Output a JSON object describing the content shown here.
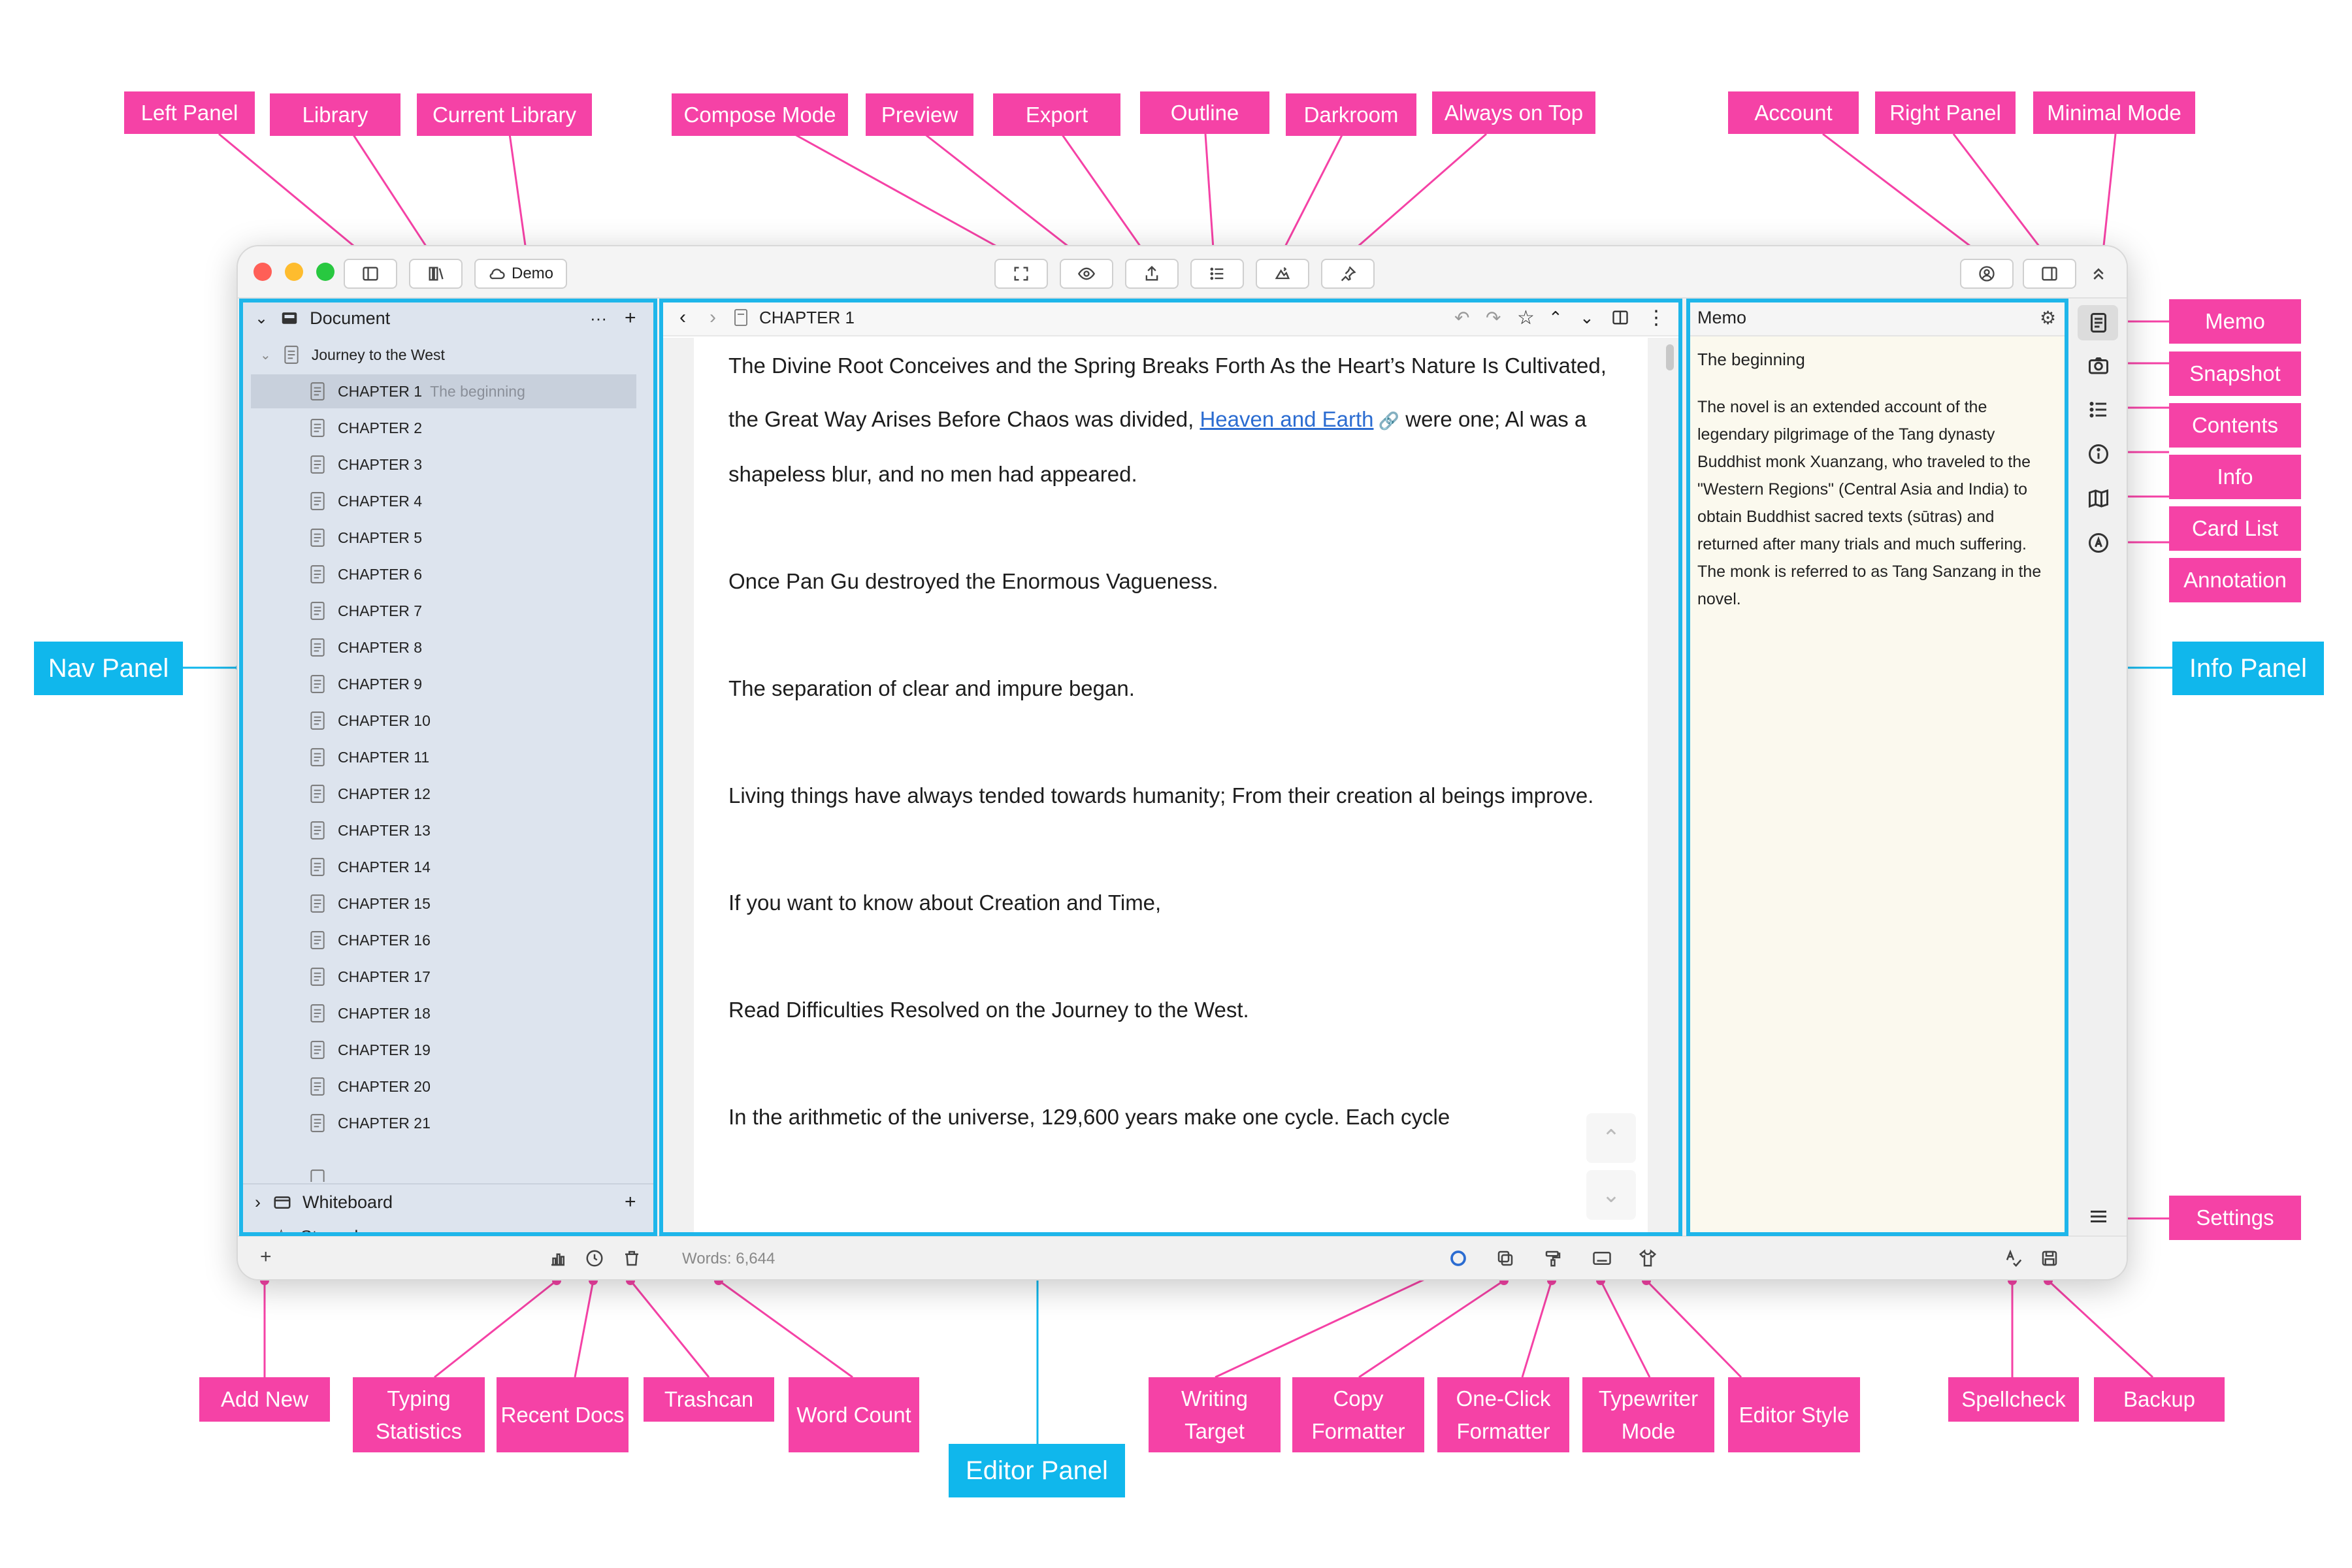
{
  "window": {
    "library_name": "Demo"
  },
  "nav": {
    "document_label": "Document",
    "more_label": "···",
    "add_label": "+",
    "root_doc": "Journey to the West",
    "chapters": [
      {
        "label": "CHAPTER 1",
        "sub": "The beginning"
      },
      {
        "label": "CHAPTER 2",
        "sub": ""
      },
      {
        "label": "CHAPTER 3",
        "sub": ""
      },
      {
        "label": "CHAPTER 4",
        "sub": ""
      },
      {
        "label": "CHAPTER 5",
        "sub": ""
      },
      {
        "label": "CHAPTER 6",
        "sub": ""
      },
      {
        "label": "CHAPTER 7",
        "sub": ""
      },
      {
        "label": "CHAPTER 8",
        "sub": ""
      },
      {
        "label": "CHAPTER 9",
        "sub": ""
      },
      {
        "label": "CHAPTER 10",
        "sub": ""
      },
      {
        "label": "CHAPTER 11",
        "sub": ""
      },
      {
        "label": "CHAPTER 12",
        "sub": ""
      },
      {
        "label": "CHAPTER 13",
        "sub": ""
      },
      {
        "label": "CHAPTER 14",
        "sub": ""
      },
      {
        "label": "CHAPTER 15",
        "sub": ""
      },
      {
        "label": "CHAPTER 16",
        "sub": ""
      },
      {
        "label": "CHAPTER 17",
        "sub": ""
      },
      {
        "label": "CHAPTER 18",
        "sub": ""
      },
      {
        "label": "CHAPTER 19",
        "sub": ""
      },
      {
        "label": "CHAPTER 20",
        "sub": ""
      },
      {
        "label": "CHAPTER 21",
        "sub": ""
      }
    ],
    "whiteboard_label": "Whiteboard",
    "starred_label": "Starred"
  },
  "editor": {
    "breadcrumb": "CHAPTER 1",
    "para1_a": "The Divine Root Conceives and the Spring Breaks Forth As the Heart’s Nature Is Cultivated, the Great Way Arises Before Chaos was divided, ",
    "para1_link": "Heaven and Earth",
    "para1_b": " were one; Al was a shapeless blur, and no men had appeared.",
    "para2": "Once Pan Gu destroyed the Enormous Vagueness.",
    "para3": "The separation of clear and impure began.",
    "para4": "Living things have always tended towards humanity; From their creation al beings improve.",
    "para5": "If you want to know about Creation and Time,",
    "para6": "Read Difficulties Resolved on the Journey to the West.",
    "para7": "In the arithmetic of the universe, 129,600 years make one cycle. Each cycle"
  },
  "info": {
    "header": "Memo",
    "title": "The beginning",
    "text": "The novel is an extended account of the legendary pilgrimage of the Tang dynasty Buddhist monk Xuanzang, who traveled to the \"Western Regions\" (Central Asia and India) to obtain Buddhist sacred texts (sūtras) and returned after many trials and much suffering. The monk is referred to as Tang Sanzang in the novel."
  },
  "status": {
    "word_count": "Words: 6,644",
    "add_label": "+"
  },
  "labels": {
    "left_panel": "Left Panel",
    "library": "Library",
    "current_library": "Current Library",
    "compose_mode": "Compose Mode",
    "preview": "Preview",
    "export": "Export",
    "outline": "Outline",
    "darkroom": "Darkroom",
    "always_on_top": "Always on Top",
    "account": "Account",
    "right_panel": "Right Panel",
    "minimal_mode": "Minimal Mode",
    "memo": "Memo",
    "snapshot": "Snapshot",
    "contents": "Contents",
    "info": "Info",
    "card_list": "Card List",
    "annotation": "Annotation",
    "settings": "Settings",
    "nav_panel": "Nav Panel",
    "info_panel": "Info Panel",
    "editor_panel": "Editor Panel",
    "add_new": "Add New",
    "typing_statistics": "Typing Statistics",
    "recent_docs": "Recent Docs",
    "trashcan": "Trashcan",
    "word_count": "Word Count",
    "writing_target": "Writing Target",
    "copy_formatter": "Copy Formatter",
    "one_click_formatter": "One-Click Formatter",
    "typewriter_mode": "Typewriter Mode",
    "editor_style": "Editor Style",
    "spellcheck": "Spellcheck",
    "backup": "Backup"
  },
  "colors": {
    "annotation_pink": "#f542a6",
    "panel_blue": "#10b7ec",
    "nav_bg": "#dde4ee",
    "memo_bg": "#fbf9ee",
    "link": "#2b6cd1"
  }
}
